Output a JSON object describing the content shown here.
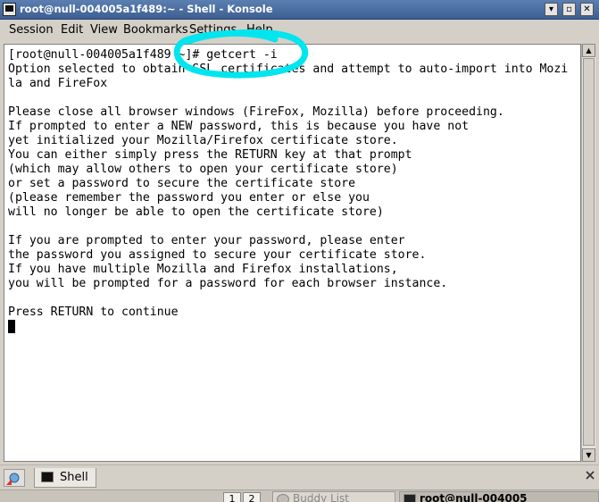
{
  "window": {
    "title": "root@null-004005a1f489:~ - Shell - Konsole",
    "minimize_glyph": "▾",
    "maximize_glyph": "▫",
    "close_glyph": "✕"
  },
  "menu": [
    "Session",
    "Edit",
    "View",
    "Bookmarks",
    "Settings",
    "Help"
  ],
  "terminal": {
    "lines": [
      "[root@null-004005a1f489 ~]# getcert -i",
      "Option selected to obtain SSL certificates and attempt to auto-import into Mozi",
      "la and FireFox",
      "",
      "Please close all browser windows (FireFox, Mozilla) before proceeding.",
      "If prompted to enter a NEW password, this is because you have not",
      "yet initialized your Mozilla/Firefox certificate store.",
      "You can either simply press the RETURN key at that prompt",
      "(which may allow others to open your certificate store)",
      "or set a password to secure the certificate store",
      "(please remember the password you enter or else you",
      "will no longer be able to open the certificate store)",
      "",
      "If you are prompted to enter your password, please enter",
      "the password you assigned to secure your certificate store.",
      "If you have multiple Mozilla and Firefox installations,",
      "you will be prompted for a password for each browser instance.",
      "",
      "Press RETURN to continue"
    ],
    "annotation_color": "#00e5ee"
  },
  "tabs": [
    {
      "label": "Shell",
      "icon": "terminal-icon"
    }
  ],
  "taskbar": {
    "desktops": [
      "1",
      "2"
    ],
    "tasks": [
      {
        "label": "Buddy List",
        "icon": "buddy-icon"
      },
      {
        "label": "root@null-004005",
        "icon": "konsole-icon"
      }
    ]
  },
  "colors": {
    "titlebar": "#4a6fa5",
    "terminal_bg": "#ffffff",
    "terminal_fg": "#000000",
    "chrome": "#d4d0c8"
  }
}
